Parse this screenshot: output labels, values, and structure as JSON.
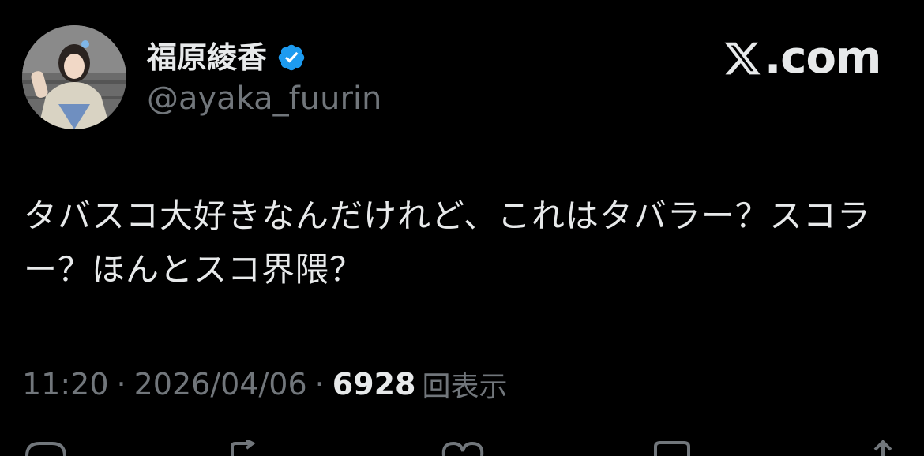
{
  "user": {
    "display_name": "福原綾香",
    "handle": "@ayaka_fuurin",
    "verified": true,
    "verified_color": "#1d9bf0",
    "avatar_icon": "profile-photo"
  },
  "watermark": {
    "text": ".com",
    "icon": "x-logo-icon"
  },
  "tweet": {
    "text": "タバスコ大好きなんだけれど、これはタバラー？スコラー？ほんとスコ界隈？"
  },
  "meta": {
    "time": "11:20",
    "separator": "·",
    "date": "2026/04/06",
    "views_count": "6928",
    "views_label": "回表示"
  },
  "actions": [
    "reply-icon",
    "retweet-icon",
    "like-icon",
    "bookmark-icon",
    "share-icon"
  ],
  "colors": {
    "background": "#000000",
    "text": "#e7e9ea",
    "muted": "#71767b"
  }
}
